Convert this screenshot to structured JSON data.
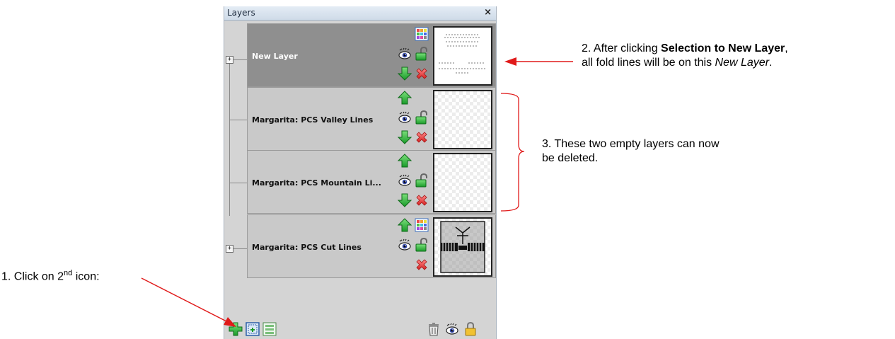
{
  "panel": {
    "title": "Layers",
    "close_glyph": "×",
    "layers": [
      {
        "name": "New Layer",
        "expandable": true,
        "selected": true
      },
      {
        "name": "Margarita: PCS Valley Lines",
        "expandable": false,
        "selected": false
      },
      {
        "name": "Margarita: PCS Mountain Li...",
        "expandable": false,
        "selected": false
      },
      {
        "name": "Margarita: PCS Cut Lines",
        "expandable": true,
        "selected": false
      }
    ],
    "expander_glyph": "+"
  },
  "annotations": {
    "note1_a": "1. Click on 2",
    "note1_sup": "nd",
    "note1_b": " icon:",
    "note2_a": "2. After clicking ",
    "note2_bold": "Selection to New Layer",
    "note2_b": ",",
    "note2_c": "all fold lines will be on this ",
    "note2_italic": "New Layer",
    "note2_d": ".",
    "note3_a": "3. These two empty layers can now",
    "note3_b": "be deleted."
  },
  "colors": {
    "arrow": "#e01a1a",
    "selected_row": "#8f8f8f",
    "normal_row": "#c9c9c9",
    "panel_bg": "#d4d4d4",
    "bracket": "#e01a1a"
  },
  "icons": [
    "color-grid-icon",
    "eye-icon",
    "lock-open-icon",
    "arrow-up-icon",
    "arrow-down-icon",
    "delete-x-icon",
    "add-layer-icon",
    "selection-to-new-layer-icon",
    "layer-list-icon",
    "trash-icon",
    "eye-all-icon",
    "lock-all-icon"
  ]
}
